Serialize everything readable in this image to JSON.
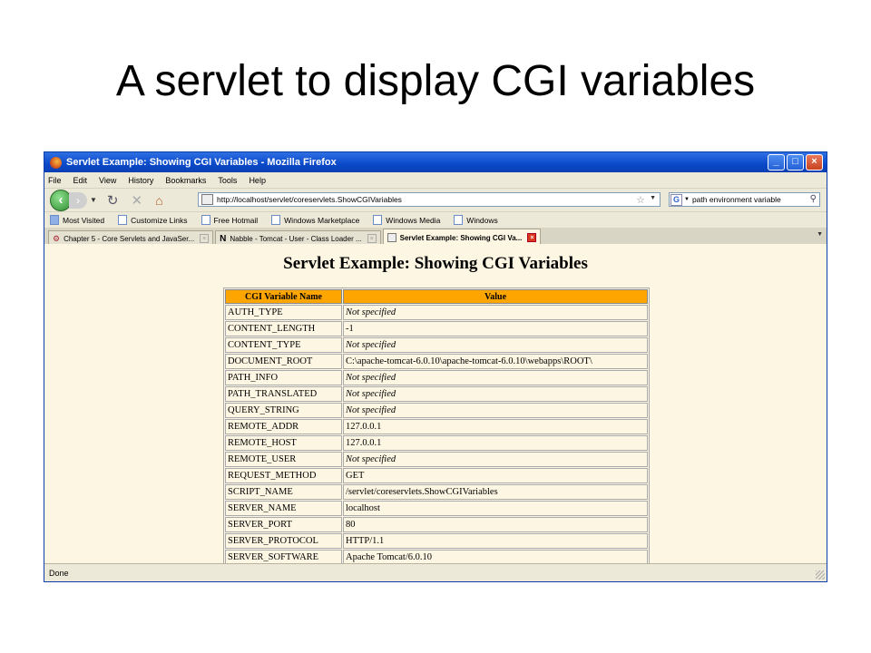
{
  "slide": {
    "title": "A servlet to display CGI variables"
  },
  "window": {
    "title": "Servlet Example: Showing CGI Variables - Mozilla Firefox",
    "controls": {
      "minimize": "_",
      "maximize": "□",
      "close": "×"
    }
  },
  "menu": [
    "File",
    "Edit",
    "View",
    "History",
    "Bookmarks",
    "Tools",
    "Help"
  ],
  "nav": {
    "url": "http://localhost/servlet/coreservlets.ShowCGIVariables",
    "search_engine": "G",
    "search_value": "path environment variable"
  },
  "bookmarks": [
    "Most Visited",
    "Customize Links",
    "Free Hotmail",
    "Windows Marketplace",
    "Windows Media",
    "Windows"
  ],
  "tabs": [
    {
      "label": "Chapter 5 - Core Servlets and JavaSer...",
      "active": false
    },
    {
      "label": "Nabble - Tomcat - User - Class Loader ...",
      "active": false
    },
    {
      "label": "Servlet Example: Showing CGI Va...",
      "active": true
    }
  ],
  "page": {
    "heading": "Servlet Example: Showing CGI Variables",
    "table": {
      "headers": [
        "CGI Variable Name",
        "Value"
      ],
      "rows": [
        {
          "name": "AUTH_TYPE",
          "value": "Not specified",
          "italic": true
        },
        {
          "name": "CONTENT_LENGTH",
          "value": "-1",
          "italic": false
        },
        {
          "name": "CONTENT_TYPE",
          "value": "Not specified",
          "italic": true
        },
        {
          "name": "DOCUMENT_ROOT",
          "value": "C:\\apache-tomcat-6.0.10\\apache-tomcat-6.0.10\\webapps\\ROOT\\",
          "italic": false
        },
        {
          "name": "PATH_INFO",
          "value": "Not specified",
          "italic": true
        },
        {
          "name": "PATH_TRANSLATED",
          "value": "Not specified",
          "italic": true
        },
        {
          "name": "QUERY_STRING",
          "value": "Not specified",
          "italic": true
        },
        {
          "name": "REMOTE_ADDR",
          "value": "127.0.0.1",
          "italic": false
        },
        {
          "name": "REMOTE_HOST",
          "value": "127.0.0.1",
          "italic": false
        },
        {
          "name": "REMOTE_USER",
          "value": "Not specified",
          "italic": true
        },
        {
          "name": "REQUEST_METHOD",
          "value": "GET",
          "italic": false
        },
        {
          "name": "SCRIPT_NAME",
          "value": "/servlet/coreservlets.ShowCGIVariables",
          "italic": false
        },
        {
          "name": "SERVER_NAME",
          "value": "localhost",
          "italic": false
        },
        {
          "name": "SERVER_PORT",
          "value": "80",
          "italic": false
        },
        {
          "name": "SERVER_PROTOCOL",
          "value": "HTTP/1.1",
          "italic": false
        },
        {
          "name": "SERVER_SOFTWARE",
          "value": "Apache Tomcat/6.0.10",
          "italic": false
        }
      ]
    }
  },
  "status": {
    "text": "Done"
  },
  "colors": {
    "header_bg": "#ffa500",
    "page_bg": "#fdf6e3",
    "titlebar": "#0a49c8"
  }
}
